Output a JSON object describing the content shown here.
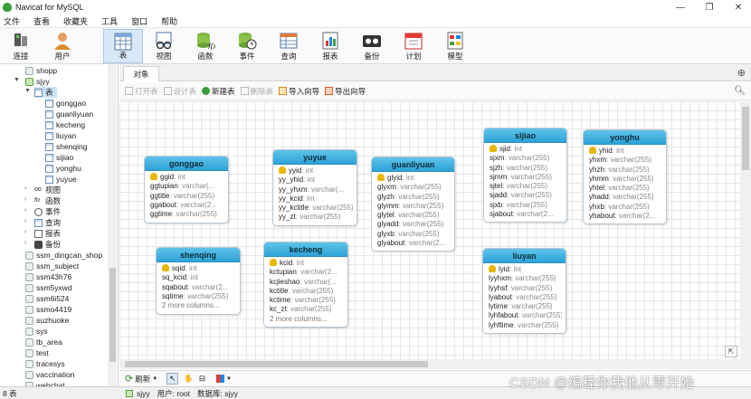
{
  "window": {
    "title": "Navicat for MySQL",
    "controls": [
      "—",
      "❐",
      "✕"
    ]
  },
  "menu": [
    "文件",
    "查看",
    "收藏夹",
    "工具",
    "窗口",
    "帮助"
  ],
  "toolbar": [
    {
      "label": "连接",
      "icon": "connection-icon"
    },
    {
      "label": "用户",
      "icon": "user-icon"
    },
    {
      "label": "表",
      "icon": "table-icon",
      "active": true
    },
    {
      "label": "视图",
      "icon": "view-icon"
    },
    {
      "label": "函数",
      "icon": "function-icon"
    },
    {
      "label": "事件",
      "icon": "event-icon"
    },
    {
      "label": "查询",
      "icon": "query-icon"
    },
    {
      "label": "报表",
      "icon": "report-icon"
    },
    {
      "label": "备份",
      "icon": "backup-icon"
    },
    {
      "label": "计划",
      "icon": "schedule-icon"
    },
    {
      "label": "模型",
      "icon": "model-icon"
    }
  ],
  "sidebar": {
    "db_top": "shopp",
    "current_db": "sjyy",
    "tables_folder": "表",
    "tables": [
      "gonggao",
      "guanliyuan",
      "kecheng",
      "liuyan",
      "shenqing",
      "sijiao",
      "yonghu",
      "yuyue"
    ],
    "folders": [
      "视图",
      "函数",
      "事件",
      "查询",
      "报表",
      "备份"
    ],
    "other_dbs": [
      "ssm_dingcan_shop",
      "ssm_subject",
      "ssm43h76",
      "ssm5yxwd",
      "ssm6i524",
      "ssmo4419",
      "suzhuoke",
      "sys",
      "tb_area",
      "test",
      "tracesys",
      "vaccination",
      "webchat"
    ]
  },
  "tabs": {
    "object": "对象",
    "add": "+"
  },
  "subtoolbar": [
    {
      "label": "打开表",
      "disabled": true
    },
    {
      "label": "设计表",
      "disabled": true
    },
    {
      "label": "新建表",
      "disabled": false
    },
    {
      "label": "删除表",
      "disabled": true
    },
    {
      "label": "导入向导",
      "disabled": false
    },
    {
      "label": "导出向导",
      "disabled": false
    }
  ],
  "entities": [
    {
      "name": "gonggao",
      "fields": [
        {
          "n": "ggid",
          "t": "int",
          "key": true
        },
        {
          "n": "ggtupian",
          "t": "varchar(..."
        },
        {
          "n": "ggtitle",
          "t": "varchar(255)"
        },
        {
          "n": "ggabout",
          "t": "varchar(2..."
        },
        {
          "n": "ggtime",
          "t": "varchar(255)"
        }
      ]
    },
    {
      "name": "yuyue",
      "fields": [
        {
          "n": "yyid",
          "t": "int",
          "key": true
        },
        {
          "n": "yy_yhid",
          "t": "int"
        },
        {
          "n": "yy_yhxm",
          "t": "varchar(..."
        },
        {
          "n": "yy_kcid",
          "t": "int"
        },
        {
          "n": "yy_kctitle",
          "t": "varchar(255)"
        },
        {
          "n": "yy_zt",
          "t": "varchar(255)"
        }
      ]
    },
    {
      "name": "guanliyuan",
      "fields": [
        {
          "n": "glyid",
          "t": "int",
          "key": true
        },
        {
          "n": "glyxm",
          "t": "varchar(255)"
        },
        {
          "n": "glyzh",
          "t": "varchar(255)"
        },
        {
          "n": "glymm",
          "t": "varchar(255)"
        },
        {
          "n": "glytel",
          "t": "varchar(255)"
        },
        {
          "n": "glyadd",
          "t": "varchar(255)"
        },
        {
          "n": "glyxb",
          "t": "varchar(255)"
        },
        {
          "n": "glyabout",
          "t": "varchar(2..."
        }
      ]
    },
    {
      "name": "sijiao",
      "fields": [
        {
          "n": "sjid",
          "t": "int",
          "key": true
        },
        {
          "n": "sjxm",
          "t": "varchar(255)"
        },
        {
          "n": "sjzh",
          "t": "varchar(255)"
        },
        {
          "n": "sjmm",
          "t": "varchar(255)"
        },
        {
          "n": "sjtel",
          "t": "varchar(255)"
        },
        {
          "n": "sjadd",
          "t": "varchar(255)"
        },
        {
          "n": "sjxb",
          "t": "varchar(255)"
        },
        {
          "n": "sjabout",
          "t": "varchar(2..."
        }
      ]
    },
    {
      "name": "yonghu",
      "fields": [
        {
          "n": "yhid",
          "t": "int",
          "key": true
        },
        {
          "n": "yhxm",
          "t": "varchar(255)"
        },
        {
          "n": "yhzh",
          "t": "varchar(255)"
        },
        {
          "n": "yhmm",
          "t": "varchar(255)"
        },
        {
          "n": "yhtel",
          "t": "varchar(255)"
        },
        {
          "n": "yhadd",
          "t": "varchar(255)"
        },
        {
          "n": "yhxb",
          "t": "varchar(255)"
        },
        {
          "n": "yhabout",
          "t": "varchar(2..."
        }
      ]
    },
    {
      "name": "shenqing",
      "fields": [
        {
          "n": "sqid",
          "t": "int",
          "key": true
        },
        {
          "n": "sq_kcid",
          "t": "int"
        },
        {
          "n": "sqabout",
          "t": "varchar(2..."
        },
        {
          "n": "sqtime",
          "t": "varchar(255)"
        }
      ],
      "more": "2 more columns..."
    },
    {
      "name": "kecheng",
      "fields": [
        {
          "n": "kcid",
          "t": "int",
          "key": true
        },
        {
          "n": "kctupian",
          "t": "varchar(2..."
        },
        {
          "n": "kcjieshao",
          "t": "varchar(..."
        },
        {
          "n": "kctitle",
          "t": "varchar(255)"
        },
        {
          "n": "kctime",
          "t": "varchar(255)"
        },
        {
          "n": "kc_zt",
          "t": "varchar(255)"
        }
      ],
      "more": "2 more columns..."
    },
    {
      "name": "liuyan",
      "fields": [
        {
          "n": "lyid",
          "t": "int",
          "key": true
        },
        {
          "n": "lyyhxm",
          "t": "varchar(255)"
        },
        {
          "n": "lyyhsf",
          "t": "varchar(255)"
        },
        {
          "n": "lyabout",
          "t": "varchar(255)"
        },
        {
          "n": "lytime",
          "t": "varchar(255)"
        },
        {
          "n": "lyhfabout",
          "t": "varchar(255)"
        },
        {
          "n": "lyhftime",
          "t": "varchar(255)"
        }
      ]
    }
  ],
  "bottombar": {
    "refresh": "刷新"
  },
  "status": {
    "count": "8 表",
    "db": "sjyy",
    "user": "用户: root",
    "database": "数据库: sjyy"
  },
  "watermark": "CSDN @编程你我他从零开始"
}
